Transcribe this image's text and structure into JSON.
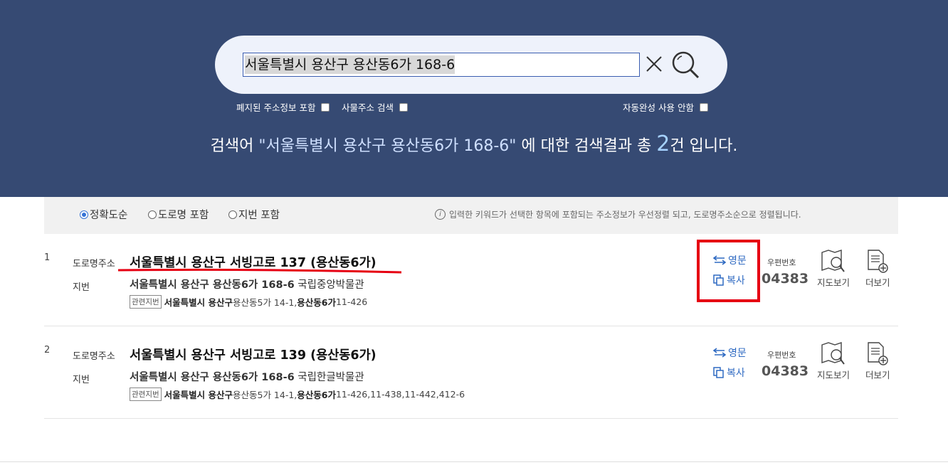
{
  "search": {
    "query": "서울특별시 용산구 용산동6가 168-6"
  },
  "options": {
    "include_closed": "폐지된 주소정보 포함",
    "building_search": "사물주소 검색",
    "no_autocomplete": "자동완성 사용 안함"
  },
  "summary": {
    "prefix": "검색어 ",
    "query_quoted": "\"서울특별시 용산구 용산동6가 168-6\"",
    "middle": " 에 대한 검색결과 총 ",
    "count": "2",
    "suffix": "건 입니다."
  },
  "filters": {
    "sort_exact": "정확도순",
    "sort_road": "도로명 포함",
    "sort_jibun": "지번 포함",
    "selected": "정확도순",
    "notice": "입력한 키워드가 선택한 항목에 포함되는 주소정보가 우선정렬 되고, 도로명주소순으로 정렬됩니다."
  },
  "labels": {
    "road_addr": "도로명주소",
    "jibun": "지번",
    "related_tag": "관련지번",
    "english": "영문",
    "copy": "복사",
    "zip_label": "우편번호",
    "map_view": "지도보기",
    "more_view": "더보기"
  },
  "results": [
    {
      "num": "1",
      "road_address": "서울특별시 용산구 서빙고로 137 (용산동6가)",
      "jibun_bold": "서울특별시 용산구 용산동6가 168-6",
      "jibun_rest": " 국립중앙박물관",
      "related_bold1": "서울특별시 용산구",
      "related_mid": " 용산동5가 14-1,",
      "related_bold2": "용산동6가",
      "related_rest": " 11-426",
      "zip": "04383"
    },
    {
      "num": "2",
      "road_address": "서울특별시 용산구 서빙고로 139 (용산동6가)",
      "jibun_bold": "서울특별시 용산구 용산동6가 168-6",
      "jibun_rest": " 국립한글박물관",
      "related_bold1": "서울특별시 용산구",
      "related_mid": " 용산동5가 14-1,",
      "related_bold2": "용산동6가",
      "related_rest": " 11-426,11-438,11-442,412-6",
      "zip": "04383"
    }
  ],
  "colors": {
    "header_bg": "#364a73",
    "accent": "#2f6ac2",
    "highlight_red": "#e60012"
  }
}
